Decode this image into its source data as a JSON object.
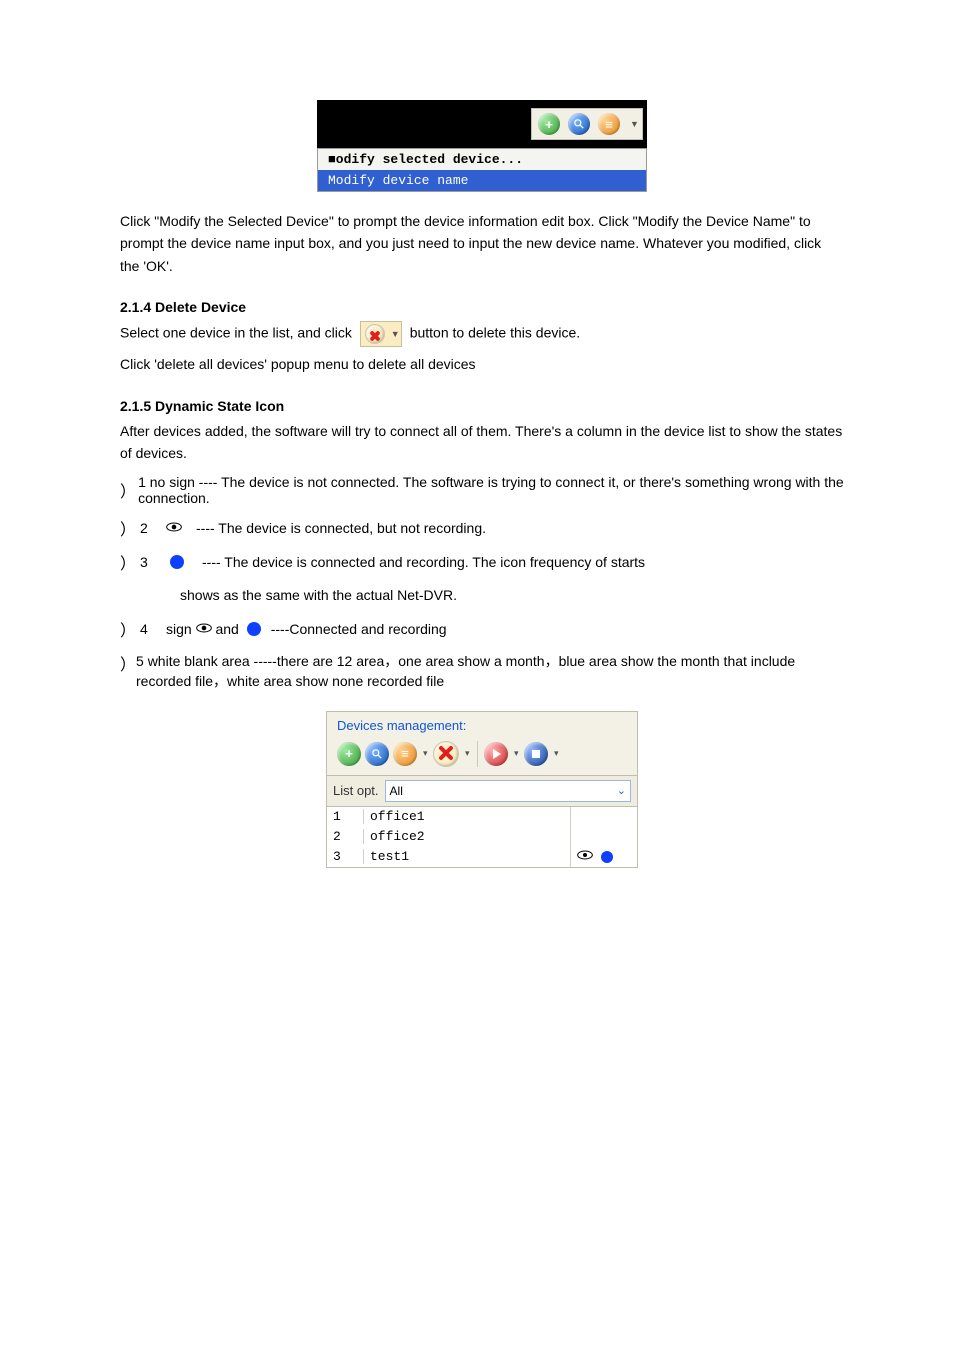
{
  "img1": {
    "menu": {
      "item1": "■odify selected device...",
      "item2": "Modify device name"
    }
  },
  "p_after_img1": "Click \"Modify the Selected Device\" to prompt the device information edit box. Click \"Modify the Device Name\" to prompt the device name input box, and you just need to input the new device name. Whatever you modified, click the 'OK'.",
  "section_del": {
    "title": "2.1.4 Delete Device",
    "line_before": "Select one device in the list, and click ",
    "line_after": "button to delete this device.",
    "line2": "Click 'delete all devices' popup menu to delete all devices"
  },
  "section_dyn": {
    "title": "2.1.5 Dynamic State Icon",
    "intro": "After devices added, the software will try to connect all of them. There's a column in the device list to show the states of devices.",
    "items": [
      "1  no sign ---- The device is not connected. The software is trying to connect it, or there's something wrong with the connection.",
      "2         ---- The device is connected, but not recording.",
      "3         ---- The device is connected and recording. The icon frequency of starts shows as the same with the actual Net-DVR.",
      "4  sign       and   ----Connected and recording",
      "5  white blank area -----there are 12 area，one area show a month，blue area show the month that include recorded file，white area show none recorded file"
    ]
  },
  "img2": {
    "fieldset_label": "Devices management:",
    "listopt_label": "List opt.",
    "listopt_value": "All",
    "rows": [
      {
        "idx": "1",
        "name": "office1",
        "eye": false,
        "dot": false
      },
      {
        "idx": "2",
        "name": "office2",
        "eye": false,
        "dot": false
      },
      {
        "idx": "3",
        "name": "test1",
        "eye": true,
        "dot": true
      }
    ]
  }
}
